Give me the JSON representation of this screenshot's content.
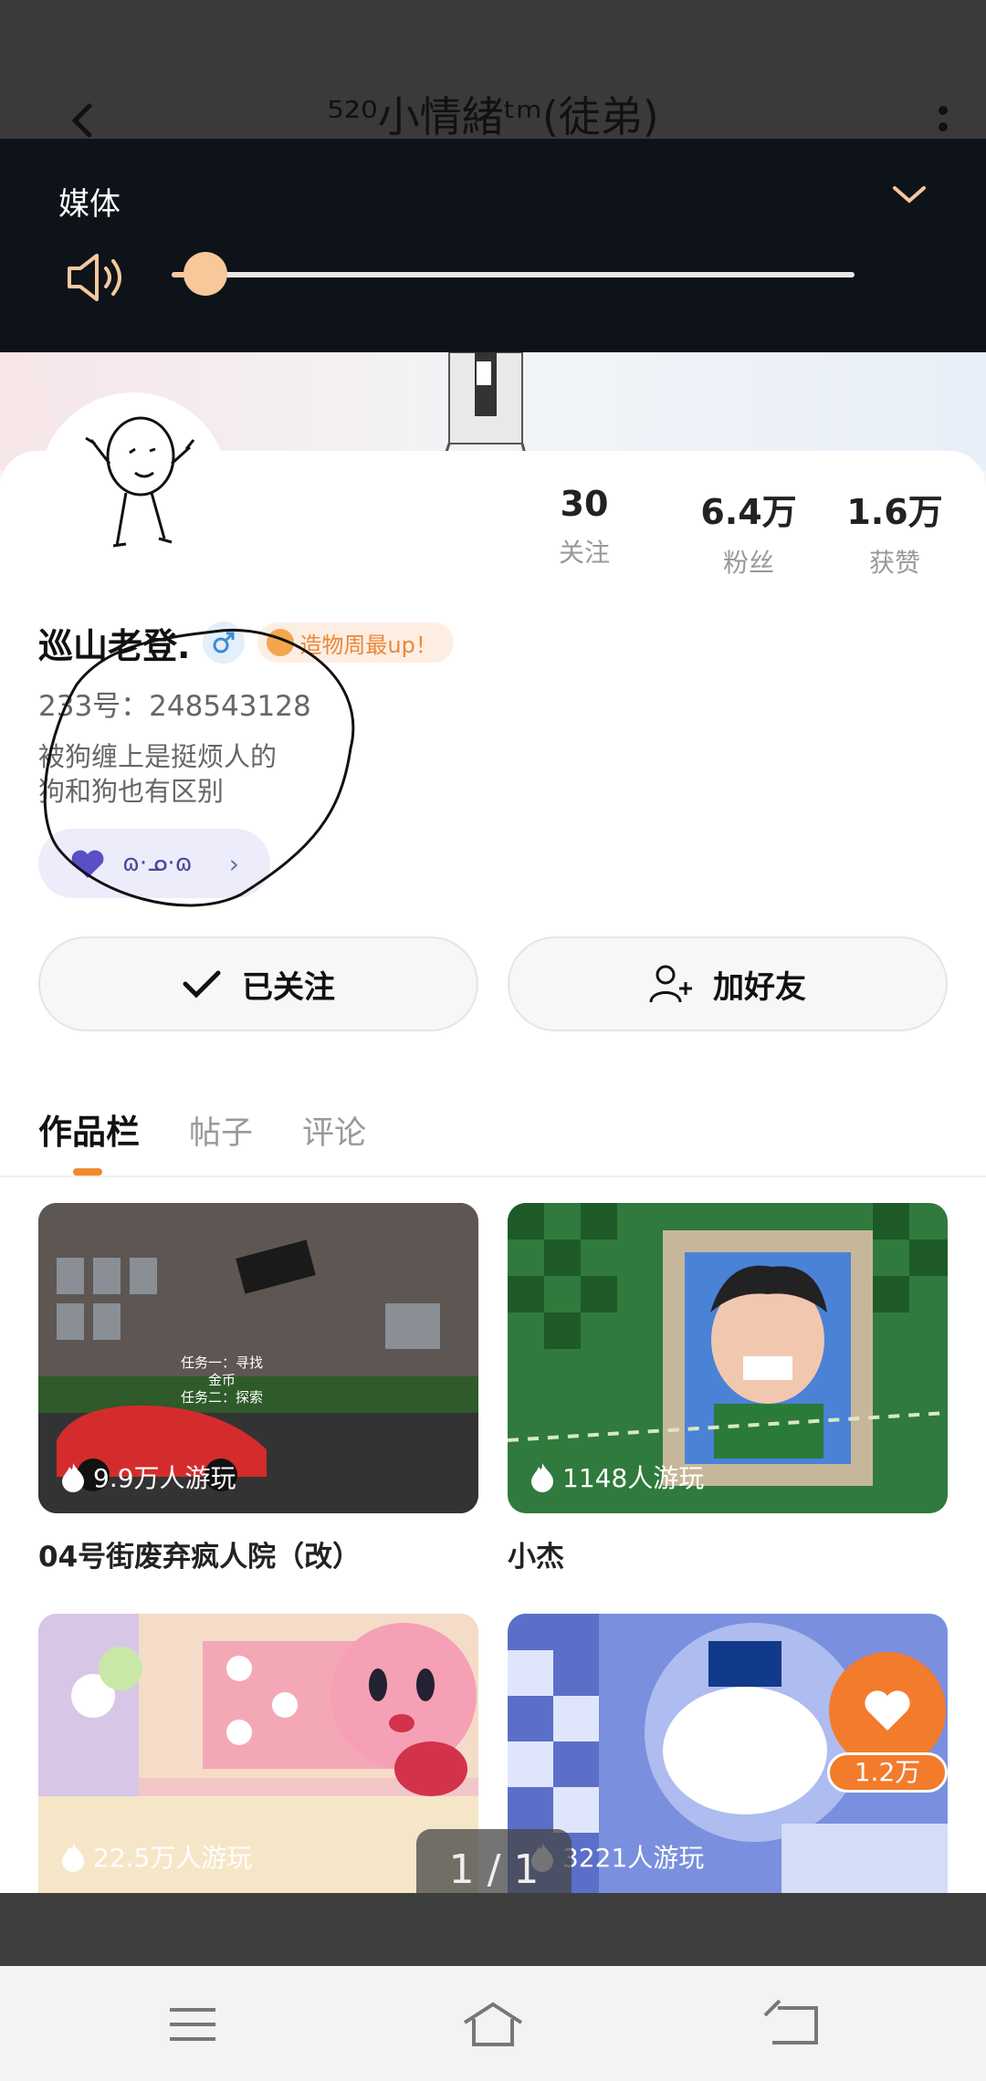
{
  "header": {
    "title": "⁵²⁰小情緒ᵗᵐ(徒弟)"
  },
  "media": {
    "label": "媒体",
    "volume_level": 0.05
  },
  "profile": {
    "name": "巡山老登.",
    "gender": "male",
    "badge": "造物周最up！",
    "uid": "233号：248543128",
    "bio_line1": "被狗缠上是挺烦人的",
    "bio_line2": "狗和狗也有区别",
    "tag_text": "ɷ·ᓄ·ɷ"
  },
  "stats": [
    {
      "value": "30",
      "label": "关注"
    },
    {
      "value": "6.4万",
      "label": "粉丝"
    },
    {
      "value": "1.6万",
      "label": "获赞"
    }
  ],
  "actions": {
    "follow_label": "已关注",
    "add_friend_label": "加好友"
  },
  "tabs": [
    {
      "label": "作品栏",
      "active": true
    },
    {
      "label": "帖子",
      "active": false
    },
    {
      "label": "评论",
      "active": false
    }
  ],
  "works": [
    {
      "plays": "9.9万人游玩",
      "title": "04号街废弃疯人院（改）",
      "thumb_text_1": "任务一：寻找",
      "thumb_text_2": "金币",
      "thumb_text_3": "任务二：探索"
    },
    {
      "plays": "1148人游玩",
      "title": "小杰"
    },
    {
      "plays": "22.5万人游玩",
      "title": ""
    },
    {
      "plays": "3221人游玩",
      "title": ""
    }
  ],
  "like": {
    "count": "1.2万"
  },
  "pager": {
    "text": "1 / 1"
  },
  "colors": {
    "accent": "#f37b2c",
    "media_bg": "#0e131a",
    "slider_knob": "#f8c89a"
  }
}
